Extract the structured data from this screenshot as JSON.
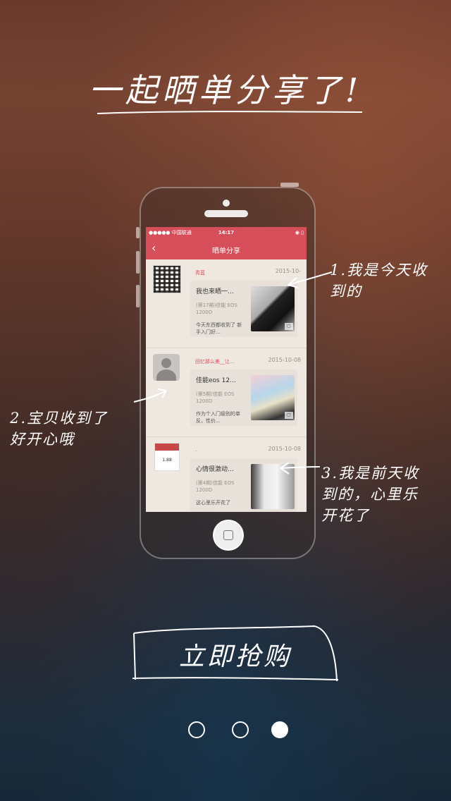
{
  "headline": "一起晒单分享了!",
  "phone": {
    "status": {
      "carrier": "●●●●● 中国联通",
      "time": "14:17",
      "battery": "◉ ▯"
    },
    "nav": {
      "title": "晒单分享",
      "back_icon": "chevron-left-icon"
    },
    "posts": [
      {
        "username": "青蓝",
        "date": "2015-10-",
        "title": "我也来晒一…",
        "sub": "(第17期)佳能 EOS 1200D",
        "desc": "今天东西都收到了 新手入门好…",
        "avatar": "qr-code"
      },
      {
        "username": "回忆那么美__让…",
        "date": "2015-10-08",
        "title": "佳能eos 12…",
        "sub": "(第5期)佳能 EOS 1200D",
        "desc": "作为个入门级别的单反，性价…",
        "avatar": "default-person"
      },
      {
        "username": ".",
        "date": "2015-10-08",
        "title": "心情很激动…",
        "sub": "(第4期)佳能 EOS 1200D",
        "desc": "这心里乐开花了",
        "avatar": "card"
      }
    ]
  },
  "annotations": {
    "one": [
      "1.我是今天收",
      "到的"
    ],
    "two": [
      "2.宝贝收到了",
      "好开心哦"
    ],
    "three": [
      "3.我是前天收",
      "到的，心里乐",
      "开花了"
    ]
  },
  "buy_button": {
    "label": "立即抢购"
  },
  "pager": {
    "count": 3,
    "active_index": 2
  }
}
